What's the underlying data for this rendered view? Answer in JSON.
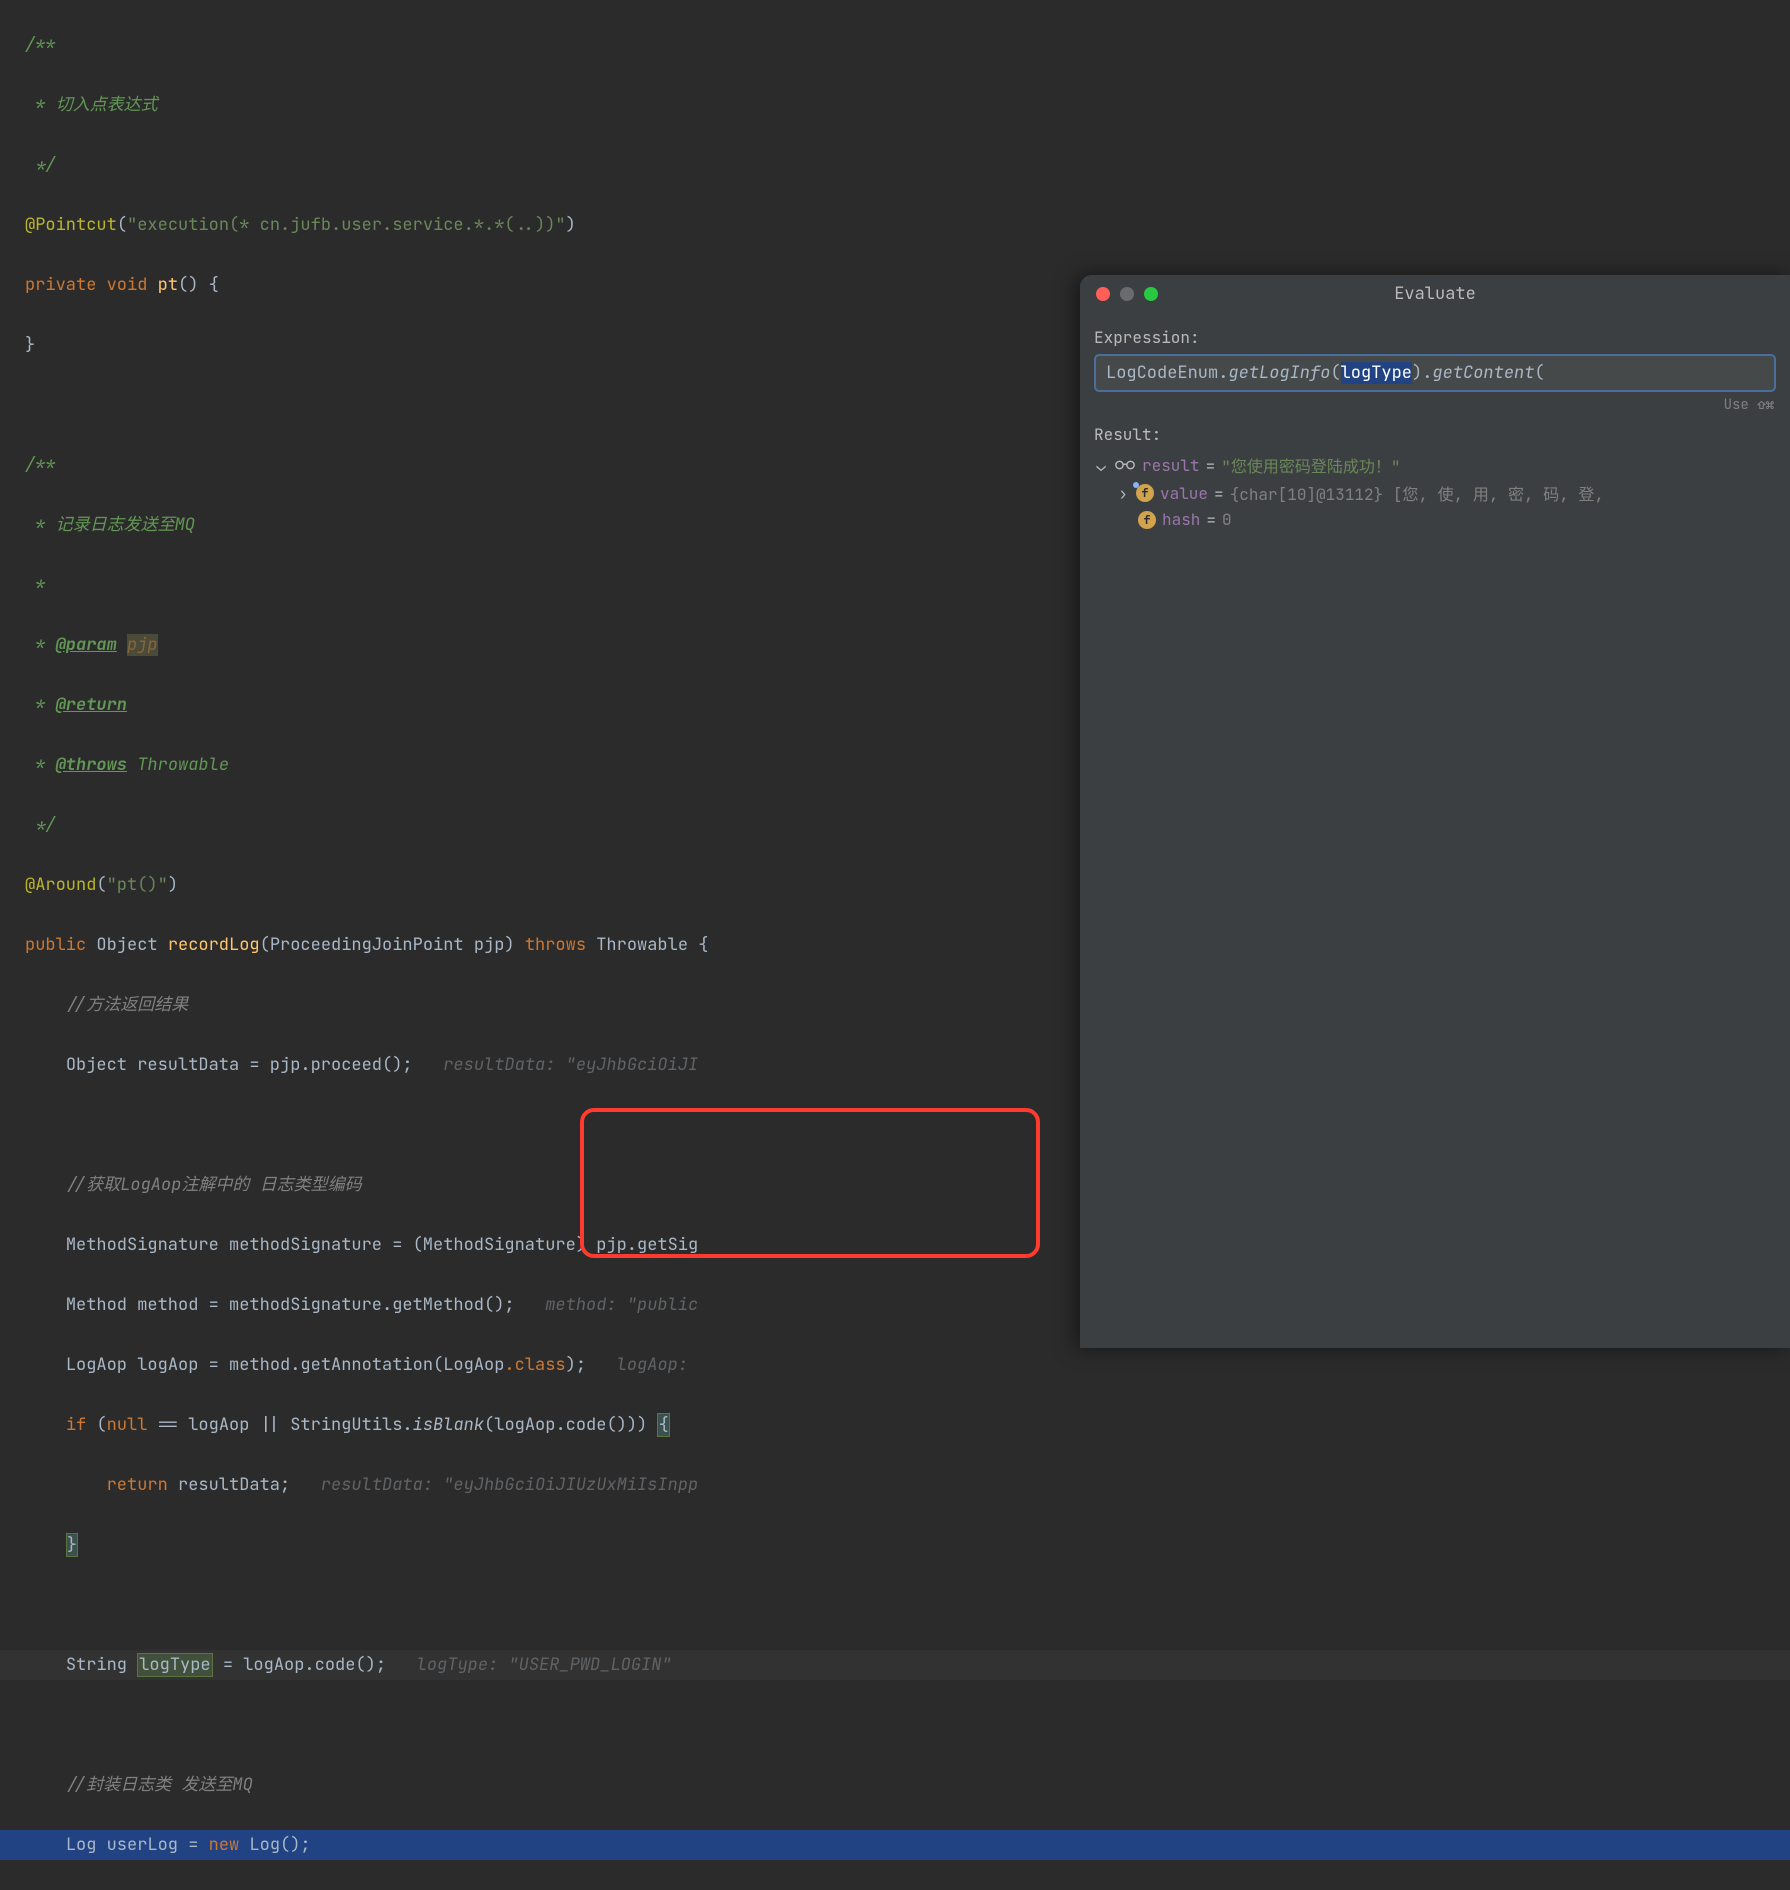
{
  "code": {
    "doc1_open": "/**",
    "doc1_l1": " * 切入点表达式",
    "doc1_close": " */",
    "pointcut_anno": "@Pointcut",
    "pointcut_str": "\"execution(* cn.jufb.user.service.*.*(..))\"",
    "private": "private",
    "void": "void",
    "pt_name": "pt",
    "pt_sig": "() {",
    "close_brace": "}",
    "doc2_open": "/**",
    "doc2_l1": " * 记录日志发送至MQ",
    "doc2_star": " *",
    "doc2_param_tag": "@param",
    "doc2_param_name": "pjp",
    "doc2_return_tag": "@return",
    "doc2_throws_tag": "@throws",
    "doc2_throws_type": "Throwable",
    "doc2_close": " */",
    "around_anno": "@Around",
    "around_str": "\"pt()\"",
    "public": "public",
    "object": "Object",
    "recordLog": "recordLog",
    "recordLog_sig": "(ProceedingJoinPoint pjp) ",
    "throws": "throws",
    "throwable": "Throwable",
    "open_brace": " {",
    "c_result": "//方法返回结果",
    "resultData_line": "Object resultData = pjp.proceed();",
    "resultData_hint": "resultData: \"eyJhbGciOiJI",
    "c_getLogAop": "//获取LogAop注解中的 日志类型编码",
    "ms_line": "MethodSignature methodSignature = (MethodSignature) pjp.getSig",
    "method_line_a": "Method method = methodSignature.getMethod();",
    "method_hint": "method: \"public",
    "logaop_a": "LogAop",
    "logaop_b": " logAop = method.getAnnotation(",
    "logaop_c": "LogAop",
    "logaop_class": ".class",
    "logaop_d": ");",
    "logaop_hint": "logAop:",
    "if": "if",
    "null": "null",
    "if_cond": " == logAop || StringUtils.",
    "isBlank": "isBlank",
    "if_cond2": "(logAop.code())) ",
    "return": "return",
    "return_rest": " resultData;",
    "return_hint": "resultData: \"eyJhbGciOiJIUzUxMiIsInpp",
    "string_kw": "String",
    "logType_var": "logType",
    "logType_rest": " = logAop.code();",
    "logType_hint": "logType: \"USER_PWD_LOGIN\"",
    "c_send": "//封装日志类 发送至MQ",
    "log_line_a": "Log userLog = ",
    "new": "new",
    "log_line_b": " Log();"
  },
  "evaluate": {
    "title": "Evaluate",
    "expression_label": "Expression:",
    "expr_class": "LogCodeEnum.",
    "expr_m1": "getLogInfo",
    "expr_open": "(",
    "expr_param": "logType",
    "expr_close": ").",
    "expr_m2": "getContent",
    "expr_tail": "(",
    "use_hint": "Use ⇧⌘",
    "result_label": "Result:",
    "result_name": "result",
    "result_value": "\"您使用密码登陆成功！\"",
    "value_name": "value",
    "value_detail": "{char[10]@13112} [您, 使, 用, 密, 码, 登,",
    "hash_name": "hash",
    "hash_value": "0"
  }
}
